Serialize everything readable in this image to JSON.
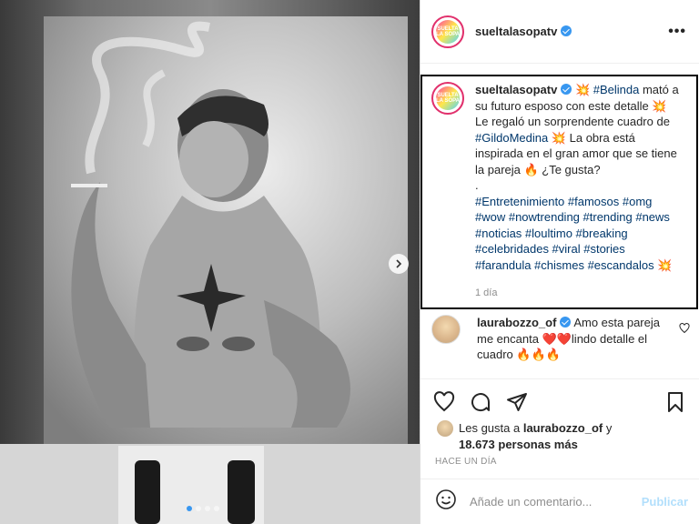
{
  "post": {
    "username": "sueltalasopatv",
    "avatar_text": "SUELTA LA SOPA",
    "more_icon_label": "•••"
  },
  "caption": {
    "username": "sueltalasopatv",
    "lines": [
      {
        "parts": [
          {
            "t": " 💥 ",
            "tag": false
          },
          {
            "t": "#Belinda",
            "tag": true
          },
          {
            "t": " mató a su futuro esposo con este detalle 💥 Le regaló un sorprendente cuadro de ",
            "tag": false
          },
          {
            "t": "#GildoMedina",
            "tag": true
          },
          {
            "t": " 💥 La obra está inspirada en el gran amor que se tiene la pareja 🔥 ¿Te gusta?",
            "tag": false
          }
        ]
      }
    ],
    "dot": ".",
    "hashtags": "#Entretenimiento #famosos #omg #wow #nowtrending #trending #news #noticias #loultimo #breaking #celebridades #viral #stories #farandula #chismes #escandalos",
    "hashtags_suffix": " 💥",
    "time": "1 día"
  },
  "comment": {
    "username": "laurabozzo_of",
    "text": "Amo esta pareja me encanta ❤️❤️lindo detalle el cuadro 🔥🔥🔥"
  },
  "likes": {
    "prefix": "Les gusta a ",
    "user": "laurabozzo_of",
    "mid": " y",
    "count": "18.673 personas más"
  },
  "timestamp": "HACE UN DÍA",
  "add_comment": {
    "placeholder": "Añade un comentario...",
    "publish_label": "Publicar"
  },
  "carousel": {
    "total": 4,
    "active_index": 0
  },
  "colors": {
    "accent": "#3897f0",
    "hashtag": "#00376b",
    "publish_disabled": "#b2dffc"
  }
}
